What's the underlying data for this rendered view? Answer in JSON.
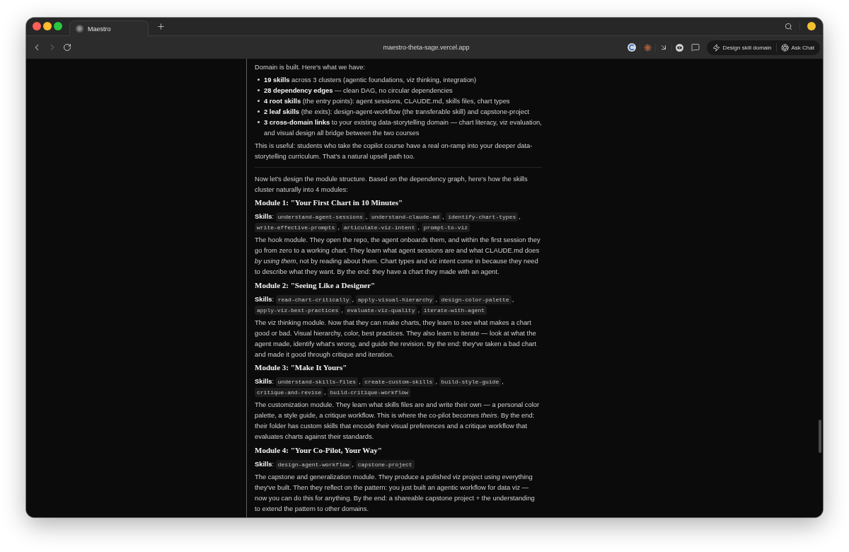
{
  "browser": {
    "tabs": [
      {
        "title": "Maestro",
        "selected": true
      }
    ],
    "navigation": {
      "back_disabled": false,
      "forward_disabled": true
    },
    "address_bar": {
      "url": "maestro-theta-sage.vercel.app"
    },
    "actions": [
      {
        "kind": "bolt",
        "label": "Design skill domain"
      },
      {
        "kind": "aperture",
        "label": "Ask Chat"
      }
    ]
  },
  "message": {
    "intro": "Domain is built. Here's what we have:",
    "bullets": [
      "**19 skills** across 3 clusters (agentic foundations, viz thinking, integration)",
      "**28 dependency edges** — clean DAG, no circular dependencies",
      "**4 root skills** (the entry points): agent sessions, CLAUDE.md, skills files, chart types",
      "**2 leaf skills** (the exits): design-agent-workflow (the transferable skill) and capstone-project",
      "**3 cross-domain links** to your existing data-storytelling domain — chart literacy, viz evaluation, and visual design all bridge between the two courses"
    ],
    "summary": "This is useful: students who take the copilot course have a real on-ramp into your deeper data-storytelling curriculum. That's a natural upsell path too.",
    "lead": "Now let's design the module structure. Based on the dependency graph, here's how the skills cluster naturally into 4 modules:",
    "modules": [
      {
        "title": "Module 1: \"Your First Chart in 10 Minutes\"",
        "skills_label": "**Skills**:",
        "skills": [
          {
            "name": "understand-agent-sessions",
            "separator": ","
          },
          {
            "name": "understand-claude-md",
            "separator": ","
          },
          {
            "name": "identify-chart-types",
            "separator": ","
          },
          {
            "name": "write-effective-prompts",
            "separator": ","
          },
          {
            "name": "articulate-viz-intent",
            "separator": ","
          },
          {
            "name": "prompt-to-viz"
          }
        ],
        "description": "The hook module. They open the repo, the agent onboards them, and within the first session they go from zero to a working chart. They learn what agent sessions are and what CLAUDE.md does *by using them*, not by reading about them. Chart types and viz intent come in because they need to describe what they want. By the end: they have a chart they made with an agent."
      },
      {
        "title": "Module 2: \"Seeing Like a Designer\"",
        "skills_label": "**Skills**:",
        "skills": [
          {
            "name": "read-chart-critically",
            "separator": ","
          },
          {
            "name": "apply-visual-hierarchy",
            "separator": ","
          },
          {
            "name": "design-color-palette",
            "separator": ","
          },
          {
            "name": "apply-viz-best-practices",
            "separator": ","
          },
          {
            "name": "evaluate-viz-quality",
            "separator": ","
          },
          {
            "name": "iterate-with-agent"
          }
        ],
        "description": "The viz thinking module. Now that they can make charts, they learn to *see* what makes a chart good or bad. Visual hierarchy, color, best practices. They also learn to iterate — look at what the agent made, identify what's wrong, and guide the revision. By the end: they've taken a bad chart and made it good through critique and iteration."
      },
      {
        "title": "Module 3: \"Make It Yours\"",
        "skills_label": "**Skills**:",
        "skills": [
          {
            "name": "understand-skills-files",
            "separator": ","
          },
          {
            "name": "create-custom-skills",
            "separator": ","
          },
          {
            "name": "build-style-guide",
            "separator": ","
          },
          {
            "name": "critique-and-revise",
            "separator": ","
          },
          {
            "name": "build-critique-workflow"
          }
        ],
        "description": "The customization module. They learn what skills files are and write their own — a personal color palette, a style guide, a critique workflow. This is where the co-pilot becomes *theirs*. By the end: their folder has custom skills that encode their visual preferences and a critique workflow that evaluates charts against their standards."
      },
      {
        "title": "Module 4: \"Your Co-Pilot, Your Way\"",
        "skills_label": "**Skills**:",
        "skills": [
          {
            "name": "design-agent-workflow",
            "separator": ","
          },
          {
            "name": "capstone-project"
          }
        ],
        "description": "The capstone and generalization module. They produce a polished viz project using everything they've built. Then they reflect on the pattern: you just built an agentic workflow for data viz — now you can do this for anything. By the end: a shareable capstone project + the understanding to extend the pattern to other domains."
      }
    ]
  }
}
